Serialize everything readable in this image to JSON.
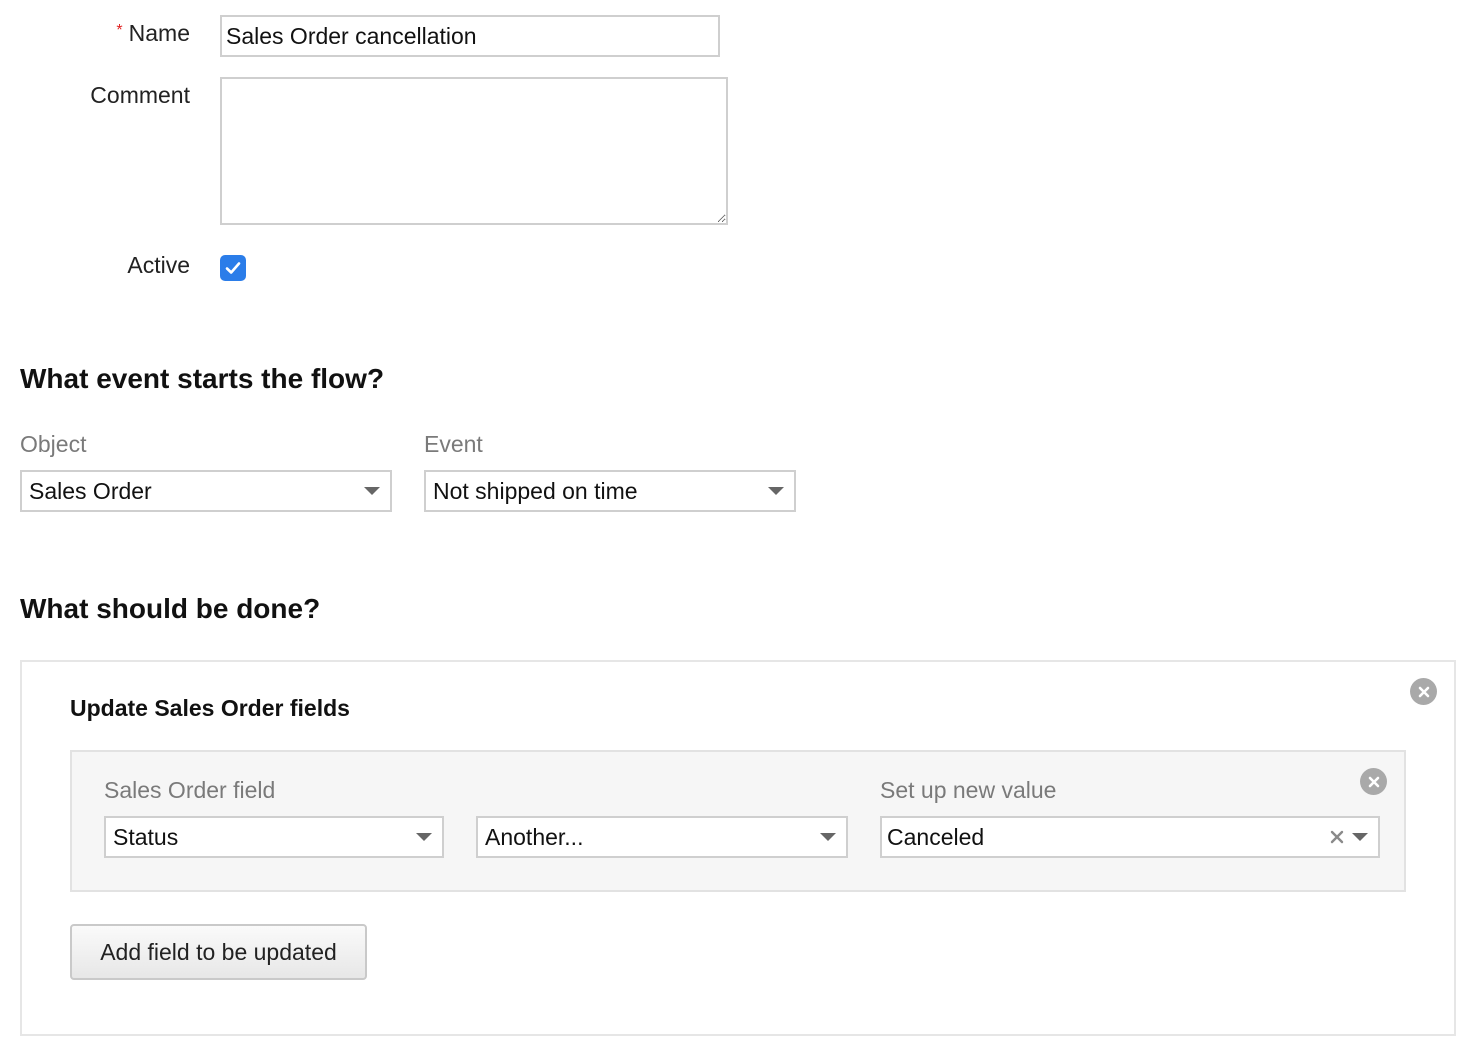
{
  "form": {
    "name_label": "Name",
    "required_mark": "*",
    "name_value": "Sales Order cancellation",
    "comment_label": "Comment",
    "comment_value": "",
    "active_label": "Active",
    "active_checked": true
  },
  "trigger": {
    "heading": "What event starts the flow?",
    "object_label": "Object",
    "object_value": "Sales Order",
    "event_label": "Event",
    "event_value": "Not shipped on time"
  },
  "action": {
    "heading": "What should be done?",
    "panel_title": "Update Sales Order fields",
    "field_label": "Sales Order field",
    "field_value": "Status",
    "mode_value": "Another...",
    "new_value_label": "Set up new value",
    "new_value": "Canceled",
    "add_button": "Add field to be updated"
  },
  "icons": {
    "checkmark": "check-icon",
    "dropdown": "chevron-down-icon",
    "remove": "close-circle-icon",
    "clear": "clear-x-icon"
  },
  "colors": {
    "checkbox": "#2b7de9",
    "required": "#e02020",
    "muted_label": "#7a7a7a"
  }
}
